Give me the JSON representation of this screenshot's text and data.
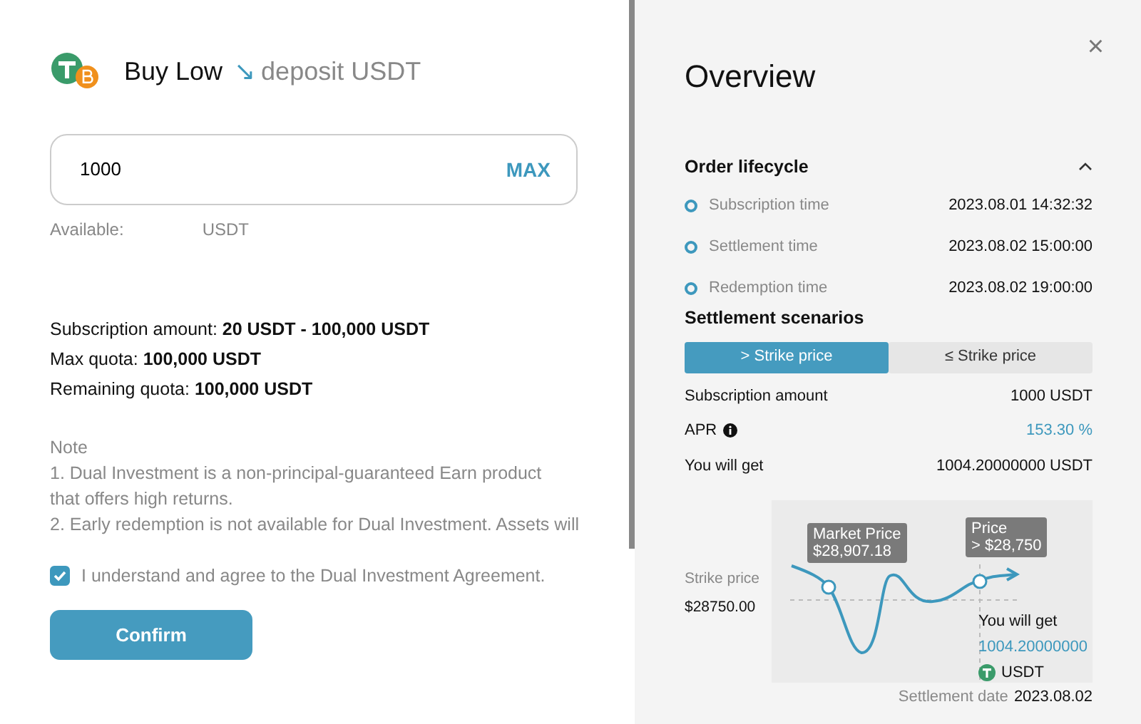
{
  "left": {
    "title": "Buy Low",
    "arrow": "↘",
    "subtitle": "deposit USDT",
    "amount_field": {
      "value": "1000",
      "max_label": "MAX"
    },
    "available": {
      "label": "Available:",
      "unit": "USDT"
    },
    "limits": [
      {
        "label": "Subscription amount:",
        "value": "20 USDT - 100,000 USDT"
      },
      {
        "label": "Max quota:",
        "value": "100,000 USDT"
      },
      {
        "label": "Remaining quota:",
        "value": "100,000 USDT"
      }
    ],
    "note": {
      "title": "Note",
      "lines": [
        "1. Dual Investment is a non-principal-guaranteed Earn product",
        "that offers high returns.",
        "2. Early redemption is not available for Dual Investment. Assets will"
      ]
    },
    "agreement": {
      "label": "I understand and agree to the Dual Investment Agreement.",
      "checked": true
    },
    "confirm_button": "Confirm"
  },
  "right": {
    "title": "Overview",
    "close": "×",
    "lifecycle": {
      "title": "Order lifecycle",
      "expanded": true,
      "steps": [
        {
          "label": "Subscription time",
          "value": "2023.08.01 14:32:32"
        },
        {
          "label": "Settlement time",
          "value": "2023.08.02 15:00:00"
        },
        {
          "label": "Redemption time",
          "value": "2023.08.02 19:00:00"
        }
      ]
    },
    "scenarios": {
      "title": "Settlement scenarios",
      "tabs": [
        {
          "label": "> Strike price",
          "selected": true
        },
        {
          "label": "≤ Strike price",
          "selected": false
        }
      ],
      "rows": [
        {
          "label": "Subscription amount",
          "value": "1000 USDT",
          "kind": "plain"
        },
        {
          "label": "APR",
          "value": "153.30 %",
          "kind": "info"
        },
        {
          "label": "You will get",
          "value": "1004.20000000 USDT",
          "kind": "plain"
        }
      ]
    },
    "chart": {
      "strike_label": "Strike price",
      "strike_value": "$28750.00",
      "market_tag": [
        "Market Price",
        "$28,907.18"
      ],
      "price_tag": [
        "Price",
        "> $28,750"
      ],
      "get_label": "You will get",
      "get_value": "1004.20000000",
      "get_unit": "USDT"
    },
    "settlement_date": {
      "label": "Settlement date",
      "value": "2023.08.02"
    }
  }
}
